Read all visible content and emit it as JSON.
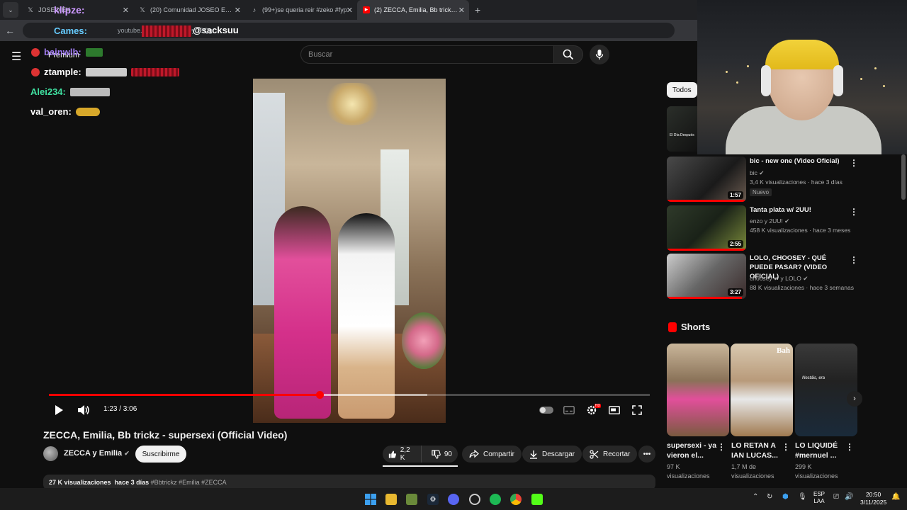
{
  "browser": {
    "tabs": [
      {
        "label": "JOSEO EX",
        "favicon": "x-icon",
        "active": false
      },
      {
        "label": "(20) Comunidad JOSEO EXCLUS",
        "favicon": "x-icon",
        "active": false
      },
      {
        "label": "(99+)se queria reir #zeko #fyp",
        "favicon": "tiktok-icon",
        "active": false
      },
      {
        "label": "(2) ZECCA, Emilia, Bb trickz - su",
        "favicon": "youtube-icon",
        "active": true
      }
    ],
    "url": "youtube.com/watch?v=...9yO8Qg"
  },
  "overlay": {
    "klipze": "klipze:",
    "cames": "Cames:",
    "sacksuu": "@sacksuu",
    "chat": [
      {
        "user": "bainwlb:",
        "color": "#a07cf0"
      },
      {
        "user": "ztample:",
        "color": "#ffffff"
      },
      {
        "user": "Alei234:",
        "color": "#3fe0a0"
      },
      {
        "user": "val_oren:",
        "color": "#ffffff"
      }
    ]
  },
  "youtube": {
    "premium_label": "Premium",
    "search_placeholder": "Buscar",
    "player": {
      "time": "1:23 / 3:06",
      "progress_fraction": 0.451,
      "buffer_fraction": 0.63
    },
    "video": {
      "title": "ZECCA, Emilia, Bb trickz - supersexi (Official Video)",
      "channel": "ZECCA y Emilia",
      "subscribe_label": "Suscribirme",
      "likes": "2,2 K",
      "dislikes": "90",
      "share_label": "Compartir",
      "download_label": "Descargar",
      "clip_label": "Recortar",
      "views": "27 K visualizaciones",
      "age": "hace 3 días",
      "tags": "#Bbtrickz #Emilia #ZECCA"
    },
    "sidebar": {
      "chip": "Todos",
      "partial_thumb_label": "El Día Después",
      "recommendations": [
        {
          "title": "bic - new one (Video Oficial)",
          "channel": "bic",
          "meta": "3,4 K visualizaciones · hace 3 días",
          "duration": "1:57",
          "badge": "Nuevo",
          "watched_fraction": 0.98
        },
        {
          "title": "Tanta plata w/ 2UU!",
          "channel": "enzo y 2UU!",
          "meta": "458 K visualizaciones · hace 3 meses",
          "duration": "2:55",
          "badge": "",
          "watched_fraction": 1.0
        },
        {
          "title": "LOLO, CHOOSEY - QUÉ PUEDE PASAR? (VIDEO OFICIAL)",
          "channel": "choosey",
          "channel2": "y LOLO",
          "meta": "88 K visualizaciones · hace 3 semanas",
          "duration": "3:27",
          "badge": "",
          "watched_fraction": 0.95
        }
      ],
      "shorts_label": "Shorts",
      "shorts": [
        {
          "title": "supersexi - ya vieron el...",
          "views": "97 K",
          "views_label": "visualizaciones"
        },
        {
          "title": "LO RETAN A IAN LUCAS...",
          "views": "1,7 M de",
          "views_label": "visualizaciones"
        },
        {
          "title": "LO LIQUIDÉ #mernuel ...",
          "views": "299 K",
          "views_label": "visualizaciones"
        }
      ],
      "short2_sign": "Bah",
      "short3_caption": "Nestáis, era"
    }
  },
  "taskbar": {
    "lang_line1": "ESP",
    "lang_line2": "LAA",
    "time": "20:50",
    "date": "3/11/2025"
  },
  "colors": {
    "yt_red": "#ff0000",
    "bg": "#0f0f0f"
  }
}
